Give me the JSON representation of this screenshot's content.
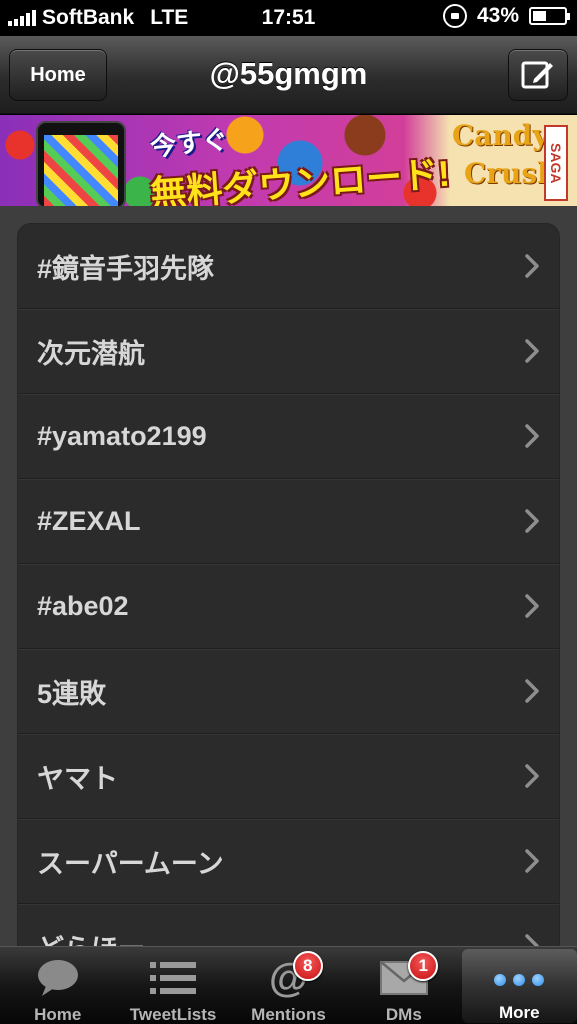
{
  "status_bar": {
    "carrier": "SoftBank",
    "network": "LTE",
    "time": "17:51",
    "battery": "43%",
    "battery_level": 0.43
  },
  "nav": {
    "home_label": "Home",
    "title": "@55gmgm",
    "compose_icon": "compose-icon"
  },
  "ad": {
    "line1": "今すぐ",
    "line2": "無料ダウンロード!",
    "logo_line1": "Candy",
    "logo_line2": "Crush",
    "logo_badge": "SAGA"
  },
  "list": {
    "items": [
      {
        "label": "#鏡音手羽先隊"
      },
      {
        "label": "次元潜航"
      },
      {
        "label": "#yamato2199"
      },
      {
        "label": "#ZEXAL"
      },
      {
        "label": "#abe02"
      },
      {
        "label": "5連敗"
      },
      {
        "label": "ヤマト"
      },
      {
        "label": "スーパームーン"
      },
      {
        "label": "どらほー"
      }
    ]
  },
  "tabs": [
    {
      "label": "Home",
      "icon": "speech-bubble-icon",
      "badge": null,
      "selected": false
    },
    {
      "label": "TweetLists",
      "icon": "list-icon",
      "badge": null,
      "selected": false
    },
    {
      "label": "Mentions",
      "icon": "at-sign-icon",
      "badge": "8",
      "selected": false
    },
    {
      "label": "DMs",
      "icon": "envelope-icon",
      "badge": "1",
      "selected": false
    },
    {
      "label": "More",
      "icon": "more-dots-icon",
      "badge": null,
      "selected": true
    }
  ],
  "colors": {
    "badge": "#d81e1e",
    "more_dots": "#3a9bf0",
    "list_bg": "#2b2b2b",
    "content_bg": "#3e3e3e"
  }
}
